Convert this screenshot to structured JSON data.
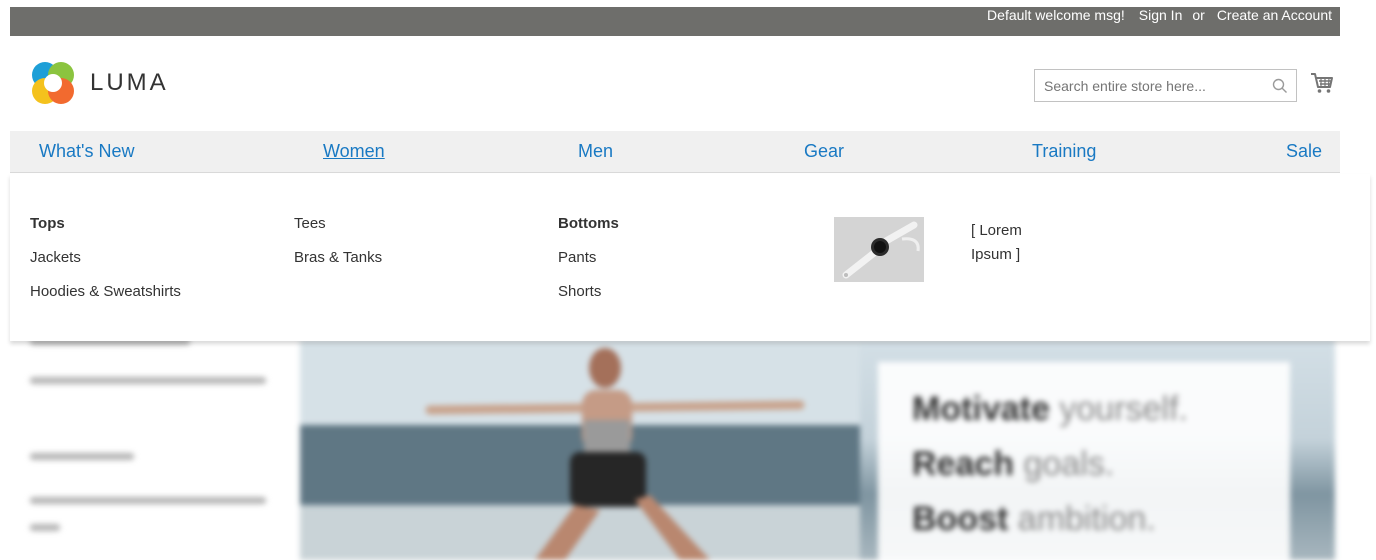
{
  "header": {
    "welcome": "Default welcome msg!",
    "sign_in": "Sign In",
    "or": "or",
    "create_account": "Create an Account",
    "logo_text": "LUMA"
  },
  "search": {
    "placeholder": "Search entire store here..."
  },
  "nav": {
    "items": [
      "What's New",
      "Women",
      "Men",
      "Gear",
      "Training",
      "Sale"
    ],
    "active": "Women"
  },
  "megamenu": {
    "col1": [
      "Tops",
      "Jackets",
      "Hoodies & Sweatshirts"
    ],
    "col2": [
      "Tees",
      "Bras & Tanks"
    ],
    "col3": [
      "Bottoms",
      "Pants",
      "Shorts"
    ],
    "promo_text": "[ Lorem Ipsum ]"
  },
  "hero": {
    "line1_bold": "Motivate",
    "line1_light": "yourself.",
    "line2_bold": "Reach",
    "line2_light": "goals.",
    "line3_bold": "Boost",
    "line3_light": "ambition."
  },
  "colors": {
    "top_bar": "#6e6e6b",
    "nav_link": "#1979c3",
    "nav_bg": "#f0f0f0"
  }
}
